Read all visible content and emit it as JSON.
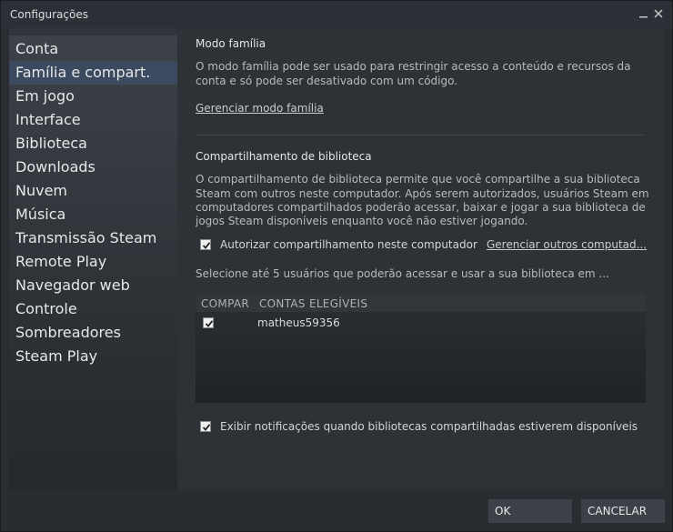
{
  "window": {
    "title": "Configurações"
  },
  "sidebar": {
    "items": [
      {
        "label": "Conta"
      },
      {
        "label": "Família e compart."
      },
      {
        "label": "Em jogo"
      },
      {
        "label": "Interface"
      },
      {
        "label": "Biblioteca"
      },
      {
        "label": "Downloads"
      },
      {
        "label": "Nuvem"
      },
      {
        "label": "Música"
      },
      {
        "label": "Transmissão Steam"
      },
      {
        "label": "Remote Play"
      },
      {
        "label": "Navegador web"
      },
      {
        "label": "Controle"
      },
      {
        "label": "Sombreadores"
      },
      {
        "label": "Steam Play"
      }
    ],
    "active_index": 1
  },
  "family": {
    "heading": "Modo família",
    "desc_line1": "O modo família pode ser usado para restringir acesso a conteúdo e recursos da",
    "desc_line2": "conta e só pode ser desativado com um código.",
    "manage_link": "Gerenciar modo família"
  },
  "sharing": {
    "heading": "Compartilhamento de biblioteca",
    "desc_line1": "O compartilhamento de biblioteca permite que você compartilhe a sua biblioteca",
    "desc_line2": "Steam com outros neste computador. Após serem autorizados, usuários Steam em",
    "desc_line3": "computadores compartilhados poderão acessar, baixar e jogar a sua biblioteca de",
    "desc_line4": "jogos Steam disponíveis enquanto você não estiver jogando.",
    "authorize_label": "Autorizar compartilhamento neste computador",
    "authorize_checked": true,
    "manage_other_link": "Gerenciar outros computad...",
    "select_hint": "Selecione até 5 usuários que poderão acessar e usar a sua biblioteca em ...",
    "table": {
      "col_share": "COMPAR",
      "col_accounts": "CONTAS ELEGÍVEIS",
      "rows": [
        {
          "account": "matheus59356",
          "checked": true
        }
      ]
    },
    "notify_label": "Exibir notificações quando bibliotecas compartilhadas estiverem disponíveis",
    "notify_checked": true
  },
  "footer": {
    "ok_label": "OK",
    "cancel_label": "CANCELAR"
  }
}
